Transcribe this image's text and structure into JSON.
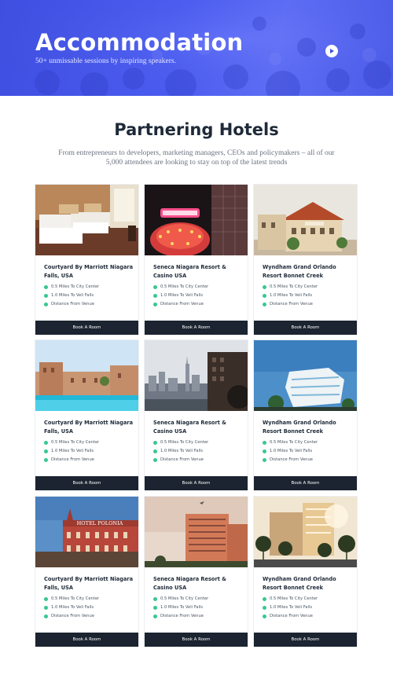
{
  "hero": {
    "title": "Accommodation",
    "subtitle": "50+ unmissable sessions by inspiring speakers.",
    "play_icon": "play-icon",
    "bg_color": "#4a5cf0"
  },
  "section": {
    "title": "Partnering Hotels",
    "description": "From entrepreneurs to developers, marketing managers, CEOs and policymakers – all of our 5,000 attendees are looking to stay on top of the latest trends"
  },
  "hotels": [
    {
      "name": "Courtyard By Marriott Niagara Falls, USA",
      "image": "hotel-bedroom",
      "features": [
        "0.5 Miles To City Center",
        "1.0 Miles To Veli Falls",
        "Distance From Venue"
      ],
      "button": "Book A Room"
    },
    {
      "name": "Seneca Niagara Resort & Casino USA",
      "image": "neon-casino-sign",
      "features": [
        "0.5 Miles To City Center",
        "1.0 Miles To Veli Falls",
        "Distance From Venue"
      ],
      "button": "Book A Room"
    },
    {
      "name": "Wyndham Grand Orlando Resort Bonnet Creek",
      "image": "hotel-building-exterior",
      "features": [
        "0.5 Miles To City Center",
        "1.0 Miles To Veli Falls",
        "Distance From Venue"
      ],
      "button": "Book A Room"
    },
    {
      "name": "Courtyard By Marriott Niagara Falls, USA",
      "image": "resort-pool",
      "features": [
        "0.5 Miles To City Center",
        "1.0 Miles To Veli Falls",
        "Distance From Venue"
      ],
      "button": "Book A Room"
    },
    {
      "name": "Seneca Niagara Resort & Casino USA",
      "image": "city-skyline",
      "features": [
        "0.5 Miles To City Center",
        "1.0 Miles To Veli Falls",
        "Distance From Venue"
      ],
      "button": "Book A Room"
    },
    {
      "name": "Wyndham Grand Orlando Resort Bonnet Creek",
      "image": "modern-building",
      "features": [
        "0.5 Miles To City Center",
        "1.0 Miles To Veli Falls",
        "Distance From Venue"
      ],
      "button": "Book A Room"
    },
    {
      "name": "Courtyard By Marriott Niagara Falls, USA",
      "image": "hotel-polonia",
      "sign_text": "HOTEL POLONIA",
      "features": [
        "0.5 Miles To City Center",
        "1.0 Miles To Veli Falls",
        "Distance From Venue"
      ],
      "button": "Book A Room"
    },
    {
      "name": "Seneca Niagara Resort & Casino USA",
      "image": "highrise-tower",
      "features": [
        "0.5 Miles To City Center",
        "1.0 Miles To Veli Falls",
        "Distance From Venue"
      ],
      "button": "Book A Room"
    },
    {
      "name": "Wyndham Grand Orlando Resort Bonnet Creek",
      "image": "palm-hotel-street",
      "features": [
        "0.5 Miles To City Center",
        "1.0 Miles To Veli Falls",
        "Distance From Venue"
      ],
      "button": "Book A Room"
    }
  ],
  "colors": {
    "accent": "#37c88f",
    "button": "#1b2430",
    "title": "#1e2a38"
  }
}
